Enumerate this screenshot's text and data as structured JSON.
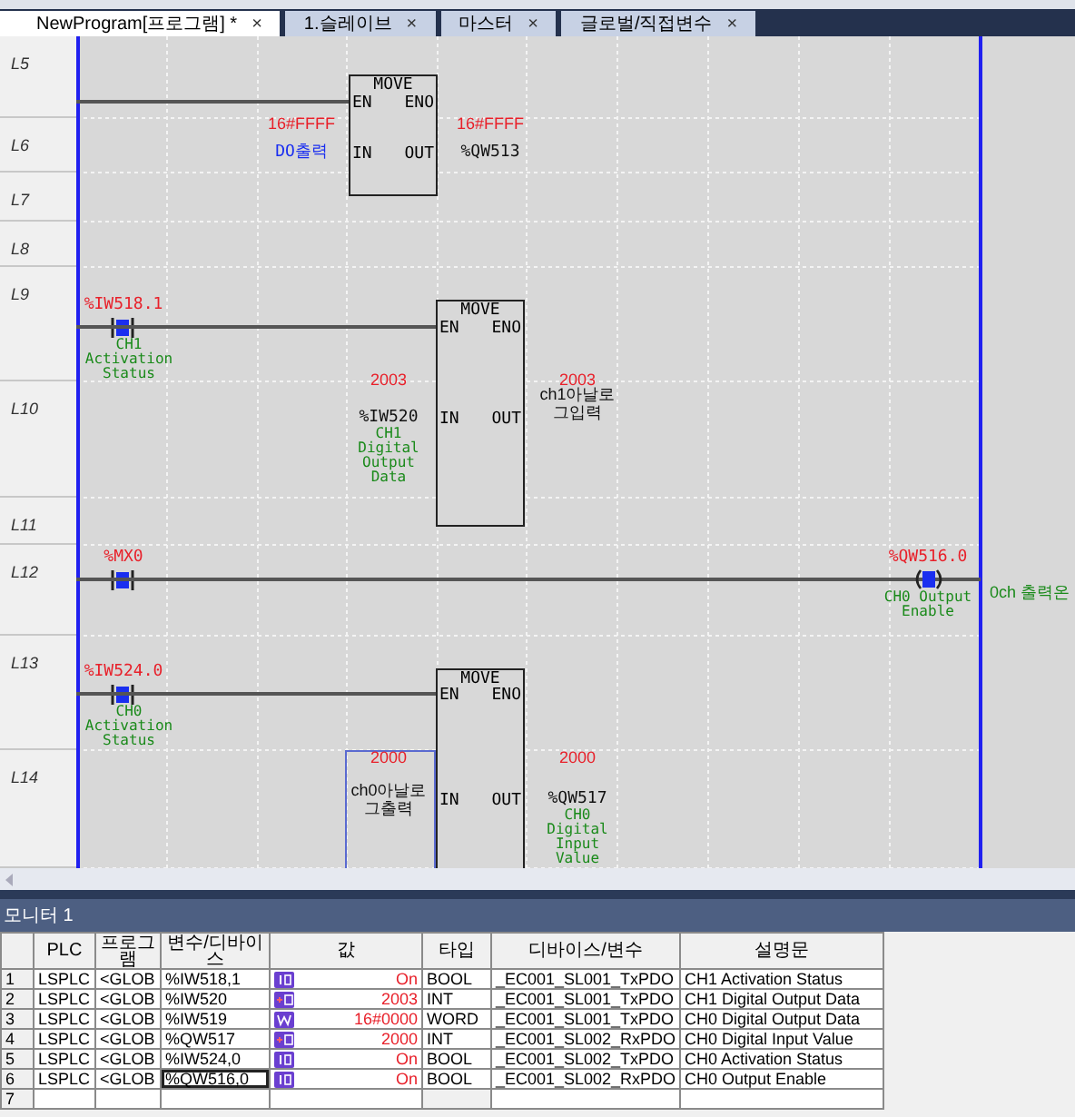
{
  "tabs": [
    {
      "label": "NewProgram[프로그램] *",
      "close": "×",
      "selected": true
    },
    {
      "label": "1.슬레이브",
      "close": "×",
      "selected": false
    },
    {
      "label": "마스터",
      "close": "×",
      "selected": false
    },
    {
      "label": "글로벌/직접변수",
      "close": "×",
      "selected": false
    }
  ],
  "row_labels": [
    "L5",
    "L6",
    "L7",
    "L8",
    "L9",
    "L10",
    "L11",
    "L12",
    "L13",
    "L14"
  ],
  "rungs": [
    {
      "kind": "move",
      "block": {
        "name": "MOVE",
        "en": "EN",
        "eno": "ENO",
        "in": "IN",
        "out": "OUT"
      },
      "in_value": "16#FFFF",
      "in_operand": "DO출력",
      "in_selected": false,
      "out_value": "16#FFFF",
      "out_operand": "%QW513"
    },
    {
      "kind": "move",
      "contact": {
        "address": "%IW518.1",
        "comment": "CH1 Activation Status",
        "on": true
      },
      "block": {
        "name": "MOVE",
        "en": "EN",
        "eno": "ENO",
        "in": "IN",
        "out": "OUT"
      },
      "in_value": "2003",
      "in_operand": "%IW520",
      "in_comment": "CH1 Digital Output Data",
      "in_selected": false,
      "out_value": "2003",
      "out_operand": "ch1아날로\n그입력"
    },
    {
      "kind": "coil",
      "contact": {
        "address": "%MX0",
        "on": true
      },
      "coil": {
        "address": "%QW516.0",
        "comment": "CH0 Output Enable",
        "on": true
      },
      "rung_comment": "0ch 출력온"
    },
    {
      "kind": "move",
      "contact": {
        "address": "%IW524.0",
        "comment": "CH0 Activation Status",
        "on": true
      },
      "block": {
        "name": "MOVE",
        "en": "EN",
        "eno": "ENO",
        "in": "IN",
        "out": "OUT"
      },
      "in_value": "2000",
      "in_operand": "ch0아날로\n그출력",
      "in_selected": true,
      "out_value": "2000",
      "out_operand": "%QW517",
      "out_comment": "CH0 Digital Input Value"
    }
  ],
  "monitor": {
    "title": "모니터 1",
    "columns": [
      "PLC",
      "프로그\n램",
      "변수/디바이스",
      "값",
      "타입",
      "디바이스/변수",
      "설명문"
    ],
    "rows": [
      {
        "num": "1",
        "plc": "LSPLC",
        "program": "<GLOB",
        "variable": "%IW518,1",
        "kind": "bool",
        "value": "On",
        "type": "BOOL",
        "device": "_EC001_SL001_TxPDO",
        "description": "CH1 Activation Status",
        "selected": false
      },
      {
        "num": "2",
        "plc": "LSPLC",
        "program": "<GLOB",
        "variable": "%IW520",
        "kind": "int",
        "value": "2003",
        "type": "INT",
        "device": "_EC001_SL001_TxPDO",
        "description": "CH1 Digital Output Data",
        "selected": false
      },
      {
        "num": "3",
        "plc": "LSPLC",
        "program": "<GLOB",
        "variable": "%IW519",
        "kind": "word",
        "value": "16#0000",
        "type": "WORD",
        "device": "_EC001_SL001_TxPDO",
        "description": "CH0 Digital Output Data",
        "selected": false
      },
      {
        "num": "4",
        "plc": "LSPLC",
        "program": "<GLOB",
        "variable": "%QW517",
        "kind": "int",
        "value": "2000",
        "type": "INT",
        "device": "_EC001_SL002_RxPDO",
        "description": "CH0 Digital Input Value",
        "selected": false
      },
      {
        "num": "5",
        "plc": "LSPLC",
        "program": "<GLOB",
        "variable": "%IW524,0",
        "kind": "bool",
        "value": "On",
        "type": "BOOL",
        "device": "_EC001_SL002_TxPDO",
        "description": "CH0 Activation Status",
        "selected": false
      },
      {
        "num": "6",
        "plc": "LSPLC",
        "program": "<GLOB",
        "variable": "%QW516,0",
        "kind": "bool",
        "value": "On",
        "type": "BOOL",
        "device": "_EC001_SL002_RxPDO",
        "description": "CH0 Output Enable",
        "selected": true
      },
      {
        "num": "7",
        "selected": false
      }
    ]
  }
}
